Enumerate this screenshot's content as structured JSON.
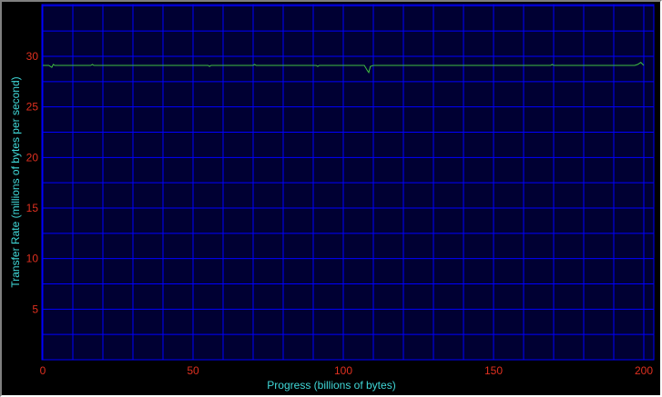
{
  "chart_data": {
    "type": "line",
    "title": "",
    "xlabel": "Progress (billions of bytes)",
    "ylabel": "Transfer Rate (millions of bytes per second)",
    "xlim": [
      0,
      200
    ],
    "ylim": [
      0,
      30
    ],
    "x_ticks": [
      0,
      50,
      100,
      150,
      200
    ],
    "y_ticks": [
      5,
      10,
      15,
      20,
      25,
      30
    ],
    "grid": true,
    "colors": {
      "background": "#000000",
      "plot_background": "#000033",
      "grid": "#0000ff",
      "line": "#40c040",
      "tick_labels": "#e03020",
      "axis_labels": "#40d8d8"
    },
    "series": [
      {
        "x": [
          0,
          2,
          3,
          3.5,
          4,
          16,
          16.5,
          17,
          55,
          55.5,
          56,
          70,
          70.5,
          71,
          91,
          91.5,
          92,
          107,
          108,
          108.5,
          109,
          110,
          169,
          169.5,
          170,
          197,
          198,
          199,
          200
        ],
        "values": [
          29.1,
          29.1,
          28.9,
          29.2,
          29.1,
          29.1,
          29.2,
          29.1,
          29.1,
          29.0,
          29.1,
          29.1,
          29.2,
          29.1,
          29.1,
          29.0,
          29.1,
          29.1,
          28.6,
          28.4,
          29.0,
          29.1,
          29.1,
          29.2,
          29.1,
          29.1,
          29.2,
          29.4,
          29.1
        ]
      }
    ]
  }
}
